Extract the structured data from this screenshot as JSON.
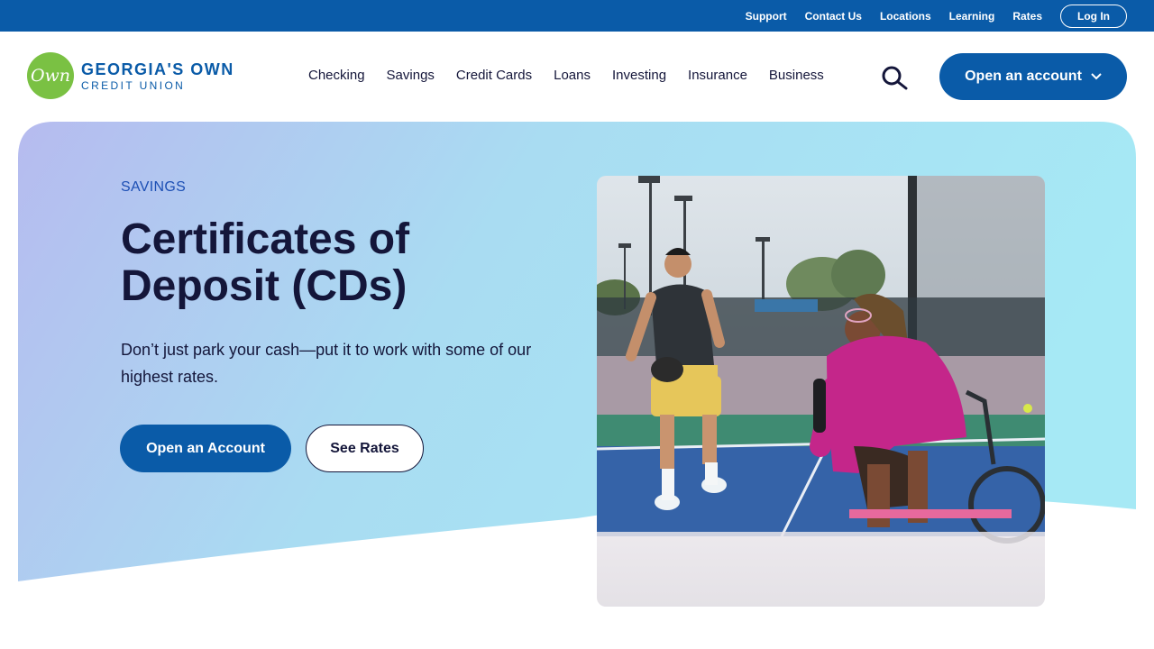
{
  "utility": {
    "links": [
      "Support",
      "Contact Us",
      "Locations",
      "Learning",
      "Rates"
    ],
    "login_label": "Log In"
  },
  "brand": {
    "logo_mark": "Own",
    "name_line1": "GEORGIA'S OWN",
    "name_line2": "CREDIT UNION",
    "colors": {
      "primary": "#0a5ba8",
      "logo_green": "#7ac143",
      "text": "#14163a"
    }
  },
  "nav": {
    "items": [
      "Checking",
      "Savings",
      "Credit Cards",
      "Loans",
      "Investing",
      "Insurance",
      "Business"
    ],
    "search_icon": "search-icon",
    "cta_label": "Open an account"
  },
  "hero": {
    "eyebrow": "SAVINGS",
    "title": "Certificates of Deposit (CDs)",
    "subtitle": "Don’t just park your cash—put it to work with some of our highest rates.",
    "primary_button": "Open an Account",
    "secondary_button": "See Rates",
    "image_subject": "pickleball-players-photo"
  }
}
